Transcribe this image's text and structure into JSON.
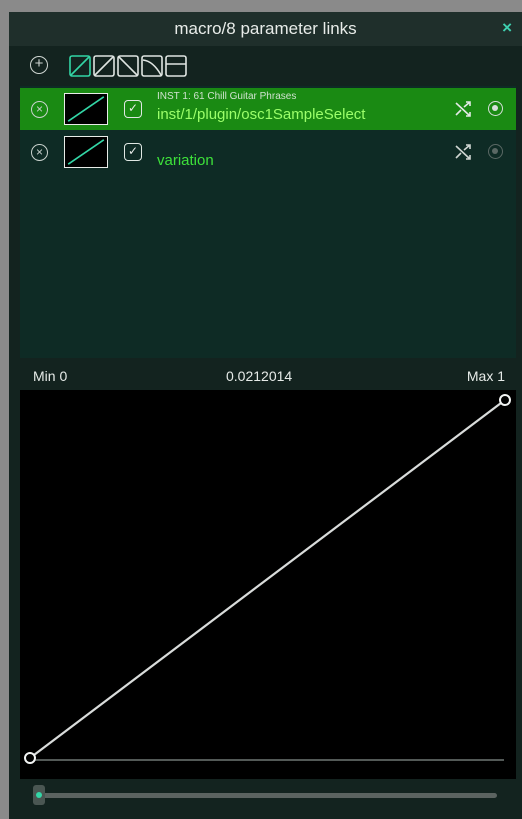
{
  "window": {
    "title": "macro/8 parameter links",
    "close_glyph": "×"
  },
  "toolbar": {
    "add_glyph": "+",
    "curve_shapes": [
      "linear-up",
      "linear-up-outline",
      "linear-down",
      "curve-convex",
      "flat-split"
    ],
    "accent_color": "#33d6a6"
  },
  "links": [
    {
      "remove_glyph": "×",
      "checked": true,
      "check_glyph": "✓",
      "subtitle": "INST 1: 61 Chill Guitar Phrases",
      "parameter": "inst/1/plugin/osc1SampleSelect",
      "selected": true,
      "row_color": "#1a8a13"
    },
    {
      "remove_glyph": "×",
      "checked": true,
      "check_glyph": "✓",
      "subtitle": "",
      "parameter": "variation",
      "selected": false
    }
  ],
  "range": {
    "min_label": "Min 0",
    "current_value": "0.0212014",
    "max_label": "Max 1"
  },
  "curve": {
    "type": "linear",
    "min": 0,
    "max": 1,
    "points": [
      [
        0,
        0
      ],
      [
        1,
        1
      ]
    ]
  },
  "slider": {
    "value": 0.0
  }
}
